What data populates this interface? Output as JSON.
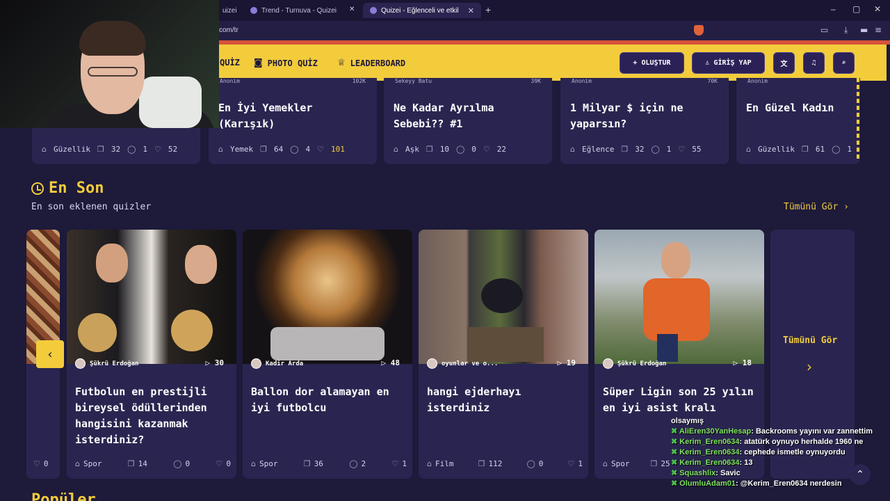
{
  "browser": {
    "tabs": [
      {
        "label": "uizei"
      },
      {
        "label": "Trend - Turnuva - Quizei"
      },
      {
        "label": "Quizei - Eğlenceli ve etkileşimli q"
      }
    ],
    "url": "com/tr",
    "new_tab": "+",
    "window": {
      "minimize": "–",
      "maximize": "▢",
      "close": "✕"
    }
  },
  "header": {
    "nav": [
      {
        "label": "QUİZ",
        "icon": "quiz-icon"
      },
      {
        "label": "PHOTO QUİZ",
        "icon": "camera-icon"
      },
      {
        "label": "LEADERBOARD",
        "icon": "trophy-icon"
      }
    ],
    "create_label": "OLUŞTUR",
    "login_label": "GİRİŞ YAP",
    "accent": "#f3cc3c"
  },
  "top_cards": [
    {
      "author": "Anonim",
      "count": "102K",
      "title": "En İyi Yemekler (Karışık)",
      "category": "Yemek",
      "questions": "64",
      "comments": "4",
      "likes": "101"
    },
    {
      "author": "Sekeyy Batu",
      "count": "39K",
      "title": "Ne Kadar Ayrılma Sebebi?? #1",
      "category": "Aşk",
      "questions": "10",
      "comments": "0",
      "likes": "22"
    },
    {
      "author": "Anonim",
      "count": "70K",
      "title": "1 Milyar $ için ne yaparsın?",
      "category": "Eğlence",
      "questions": "32",
      "comments": "1",
      "likes": "55"
    },
    {
      "author": "Anonim",
      "count": "",
      "title": "En Güzel Kadın",
      "category": "Güzellik",
      "questions": "61",
      "comments": "1",
      "likes": ""
    }
  ],
  "left_partial_card": {
    "category": "Güzellik",
    "questions": "32",
    "comments": "1",
    "likes": "52"
  },
  "section": {
    "title": "En Son",
    "subtitle": "En son eklenen quizler",
    "see_all": "Tümünü Gör ›"
  },
  "quizzes": [
    {
      "author": "Şükrü Erdoğan",
      "plays": "▷ 30",
      "title": "Futbolun en prestijli bireysel ödüllerinden hangisini kazanmak isterdiniz?",
      "category": "Spor",
      "questions": "14",
      "comments": "0",
      "likes": "0"
    },
    {
      "author": "Kadir Arda",
      "plays": "▷ 48",
      "title": "Ballon dor alamayan en iyi futbolcu",
      "category": "Spor",
      "questions": "36",
      "comments": "2",
      "likes": "1"
    },
    {
      "author": "oyunlar ve o...",
      "plays": "▷ 19",
      "title": "hangi ejderhayı isterdiniz",
      "category": "Film",
      "questions": "112",
      "comments": "0",
      "likes": "1"
    },
    {
      "author": "Şükrü Erdoğan",
      "plays": "▷ 18",
      "title": "Süper Ligin son 25 yılın en iyi asist kralı",
      "category": "Spor",
      "questions": "25",
      "comments": "",
      "likes": ""
    }
  ],
  "left_partial_quiz": {
    "likes": "0"
  },
  "see_all_card": {
    "label": "Tümünü Gör",
    "arrow": "›"
  },
  "prev_arrow": "‹",
  "chat": [
    {
      "user": "",
      "msg": "olsaymış"
    },
    {
      "user": "AliEren30YanHesap",
      "msg": "Backrooms yayını var zannettim"
    },
    {
      "user": "Kerim_Eren0634",
      "msg": "atatürk oynuyo herhalde 1960 ne"
    },
    {
      "user": "Kerim_Eren0634",
      "msg": "cephede ismetle oynuyordu"
    },
    {
      "user": "Kerim_Eren0634",
      "msg": "13"
    },
    {
      "user": "Squashlix",
      "msg": "Savic"
    },
    {
      "user": "OlumluAdam01",
      "msg": "@Kerim_Eren0634 nerdesin"
    }
  ],
  "bottom_section_title": "Popüler"
}
